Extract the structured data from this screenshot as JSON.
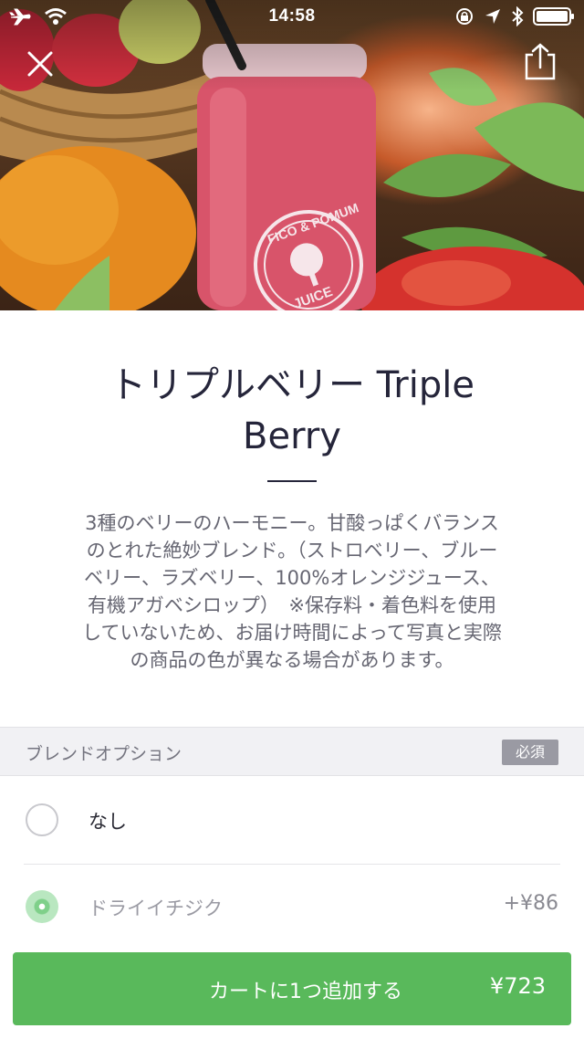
{
  "status_bar": {
    "time": "14:58"
  },
  "hero": {
    "jar_label_top": "FICO & POMUM",
    "jar_label_bottom": "JUICE"
  },
  "product": {
    "title": "トリプルベリー Triple Berry",
    "description": "3種のベリーのハーモニー。甘酸っぱくバランス\nのとれた絶妙ブレンド。（ストロベリー、ブルー\nベリー、ラズベリー、100%オレンジジュース、\n有機アガベシロップ）　※保存料・着色料を使用\nしていないため、お届け時間によって写真と実際\nの商品の色が異なる場合があります。"
  },
  "options": {
    "section_title": "ブレンドオプション",
    "required_label": "必須",
    "items": [
      {
        "label": "なし",
        "price": "",
        "selected": false
      },
      {
        "label": "ドライイチジク",
        "price": "+¥86",
        "selected": true
      }
    ]
  },
  "cart": {
    "button_label": "カートに1つ追加する",
    "total": "¥723"
  },
  "colors": {
    "accent_green": "#59b95b",
    "title_text": "#25253a",
    "body_text": "#666672"
  },
  "icons": {
    "close": "close-icon",
    "share": "share-icon",
    "airplane": "airplane-icon",
    "wifi": "wifi-icon",
    "location": "location-arrow-icon",
    "bluetooth": "bluetooth-icon",
    "battery": "battery-icon",
    "lock_rotation": "lock-rotation-icon"
  }
}
